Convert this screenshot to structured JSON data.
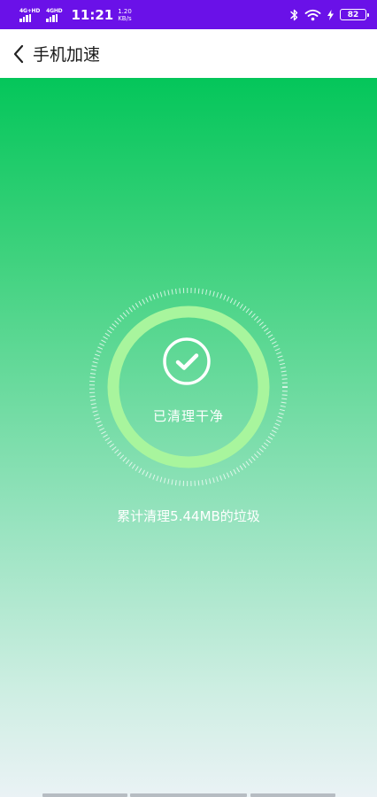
{
  "status_bar": {
    "sim1_label": "4G+HD",
    "sim2_label": "4GHD",
    "time": "11:21",
    "speed_value": "1.20",
    "speed_unit": "KB/s",
    "battery": "82"
  },
  "header": {
    "title": "手机加速"
  },
  "main": {
    "status": "已清理干净",
    "summary": "累计清理5.44MB的垃圾"
  },
  "colors": {
    "status_bar_bg": "#6a11e8",
    "gradient_top": "#04c65a",
    "gradient_bottom": "#eaf2f5",
    "ring": "#a8f59d"
  }
}
